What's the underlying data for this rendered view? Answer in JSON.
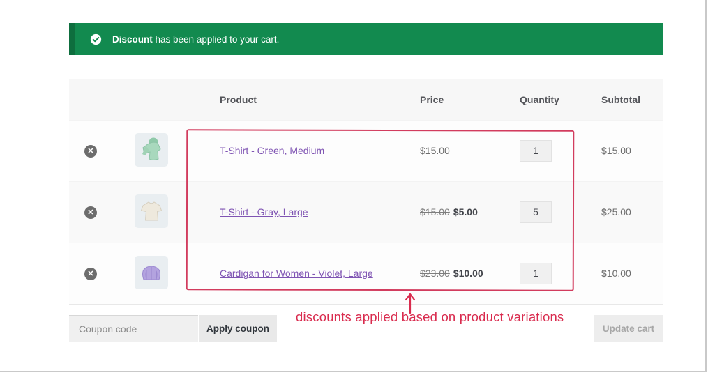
{
  "banner": {
    "icon": "check-circle-icon",
    "bold": "Discount",
    "rest": " has been applied to your cart."
  },
  "table": {
    "headers": {
      "product": "Product",
      "price": "Price",
      "quantity": "Quantity",
      "subtotal": "Subtotal"
    },
    "rows": [
      {
        "name": "T-Shirt - Green, Medium",
        "price": "$15.00",
        "qty": "1",
        "subtotal": "$15.00",
        "thumbnail": "green-hoodie"
      },
      {
        "name": "T-Shirt - Gray, Large",
        "price_old": "$15.00",
        "price_new": "$5.00",
        "qty": "5",
        "subtotal": "$25.00",
        "thumbnail": "gray-tshirt"
      },
      {
        "name": "Cardigan for Women - Violet, Large",
        "price_old": "$23.00",
        "price_new": "$10.00",
        "qty": "1",
        "subtotal": "$10.00",
        "thumbnail": "violet-cardigan"
      }
    ],
    "remove_icon": "circle-x-icon"
  },
  "coupon": {
    "placeholder": "Coupon code",
    "apply_label": "Apply coupon",
    "update_label": "Update cart"
  },
  "annotation": {
    "text": "discounts applied based on product variations",
    "shapes": [
      "hand-drawn-rectangle",
      "up-arrow"
    ]
  },
  "colors": {
    "banner_green": "#128a4f",
    "banner_green_dark": "#0e6e3e",
    "annotation_red": "#d92b4e",
    "link_purple": "#7f54b3"
  }
}
